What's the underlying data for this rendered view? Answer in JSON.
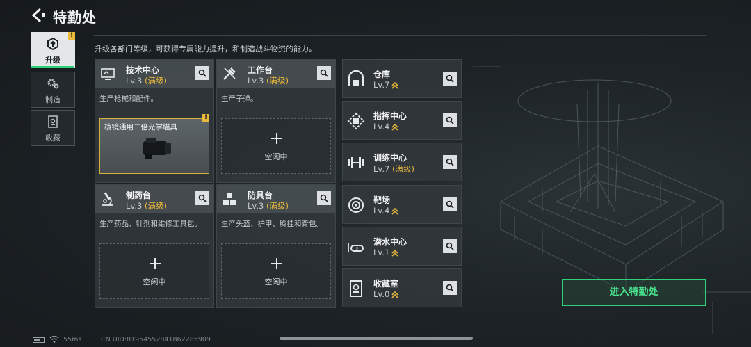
{
  "header": {
    "title": "特勤处"
  },
  "sidebar": {
    "tabs": [
      {
        "label": "升级",
        "alert": "!"
      },
      {
        "label": "制造"
      },
      {
        "label": "收藏"
      }
    ]
  },
  "description": "升级各部门等级，可获得专属能力提升，和制造战斗物资的能力。",
  "workshops": [
    {
      "name": "技术中心",
      "level": "Lv.3",
      "max": "(满级)",
      "subtitle": "生产枪械和配件。",
      "slot_item": "棱镜通用二倍光学瞄具",
      "slot_alert": "!"
    },
    {
      "name": "工作台",
      "level": "Lv.3",
      "max": "(满级)",
      "subtitle": "生产子弹。",
      "slot_label": "空闲中"
    },
    {
      "name": "制药台",
      "level": "Lv.3",
      "max": "(满级)",
      "subtitle": "生产药品、针剂和维修工具包。",
      "slot_label": "空闲中"
    },
    {
      "name": "防具台",
      "level": "Lv.3",
      "max": "(满级)",
      "subtitle": "生产头盔、护甲、胸挂和背包。",
      "slot_label": "空闲中"
    }
  ],
  "departments": [
    {
      "name": "仓库",
      "level": "Lv.7",
      "max": ""
    },
    {
      "name": "指挥中心",
      "level": "Lv.4",
      "max": ""
    },
    {
      "name": "训练中心",
      "level": "Lv.7",
      "max": "(满级)"
    },
    {
      "name": "靶场",
      "level": "Lv.4",
      "max": ""
    },
    {
      "name": "潜水中心",
      "level": "Lv.1",
      "max": ""
    },
    {
      "name": "收藏室",
      "level": "Lv.0",
      "max": ""
    }
  ],
  "enter_button": "进入特勤处",
  "footer": {
    "ping": "55ms",
    "uid": "CN UID:8195455284186228590​9"
  },
  "colors": {
    "accent": "#2fd07a",
    "gold": "#e8b93a"
  }
}
